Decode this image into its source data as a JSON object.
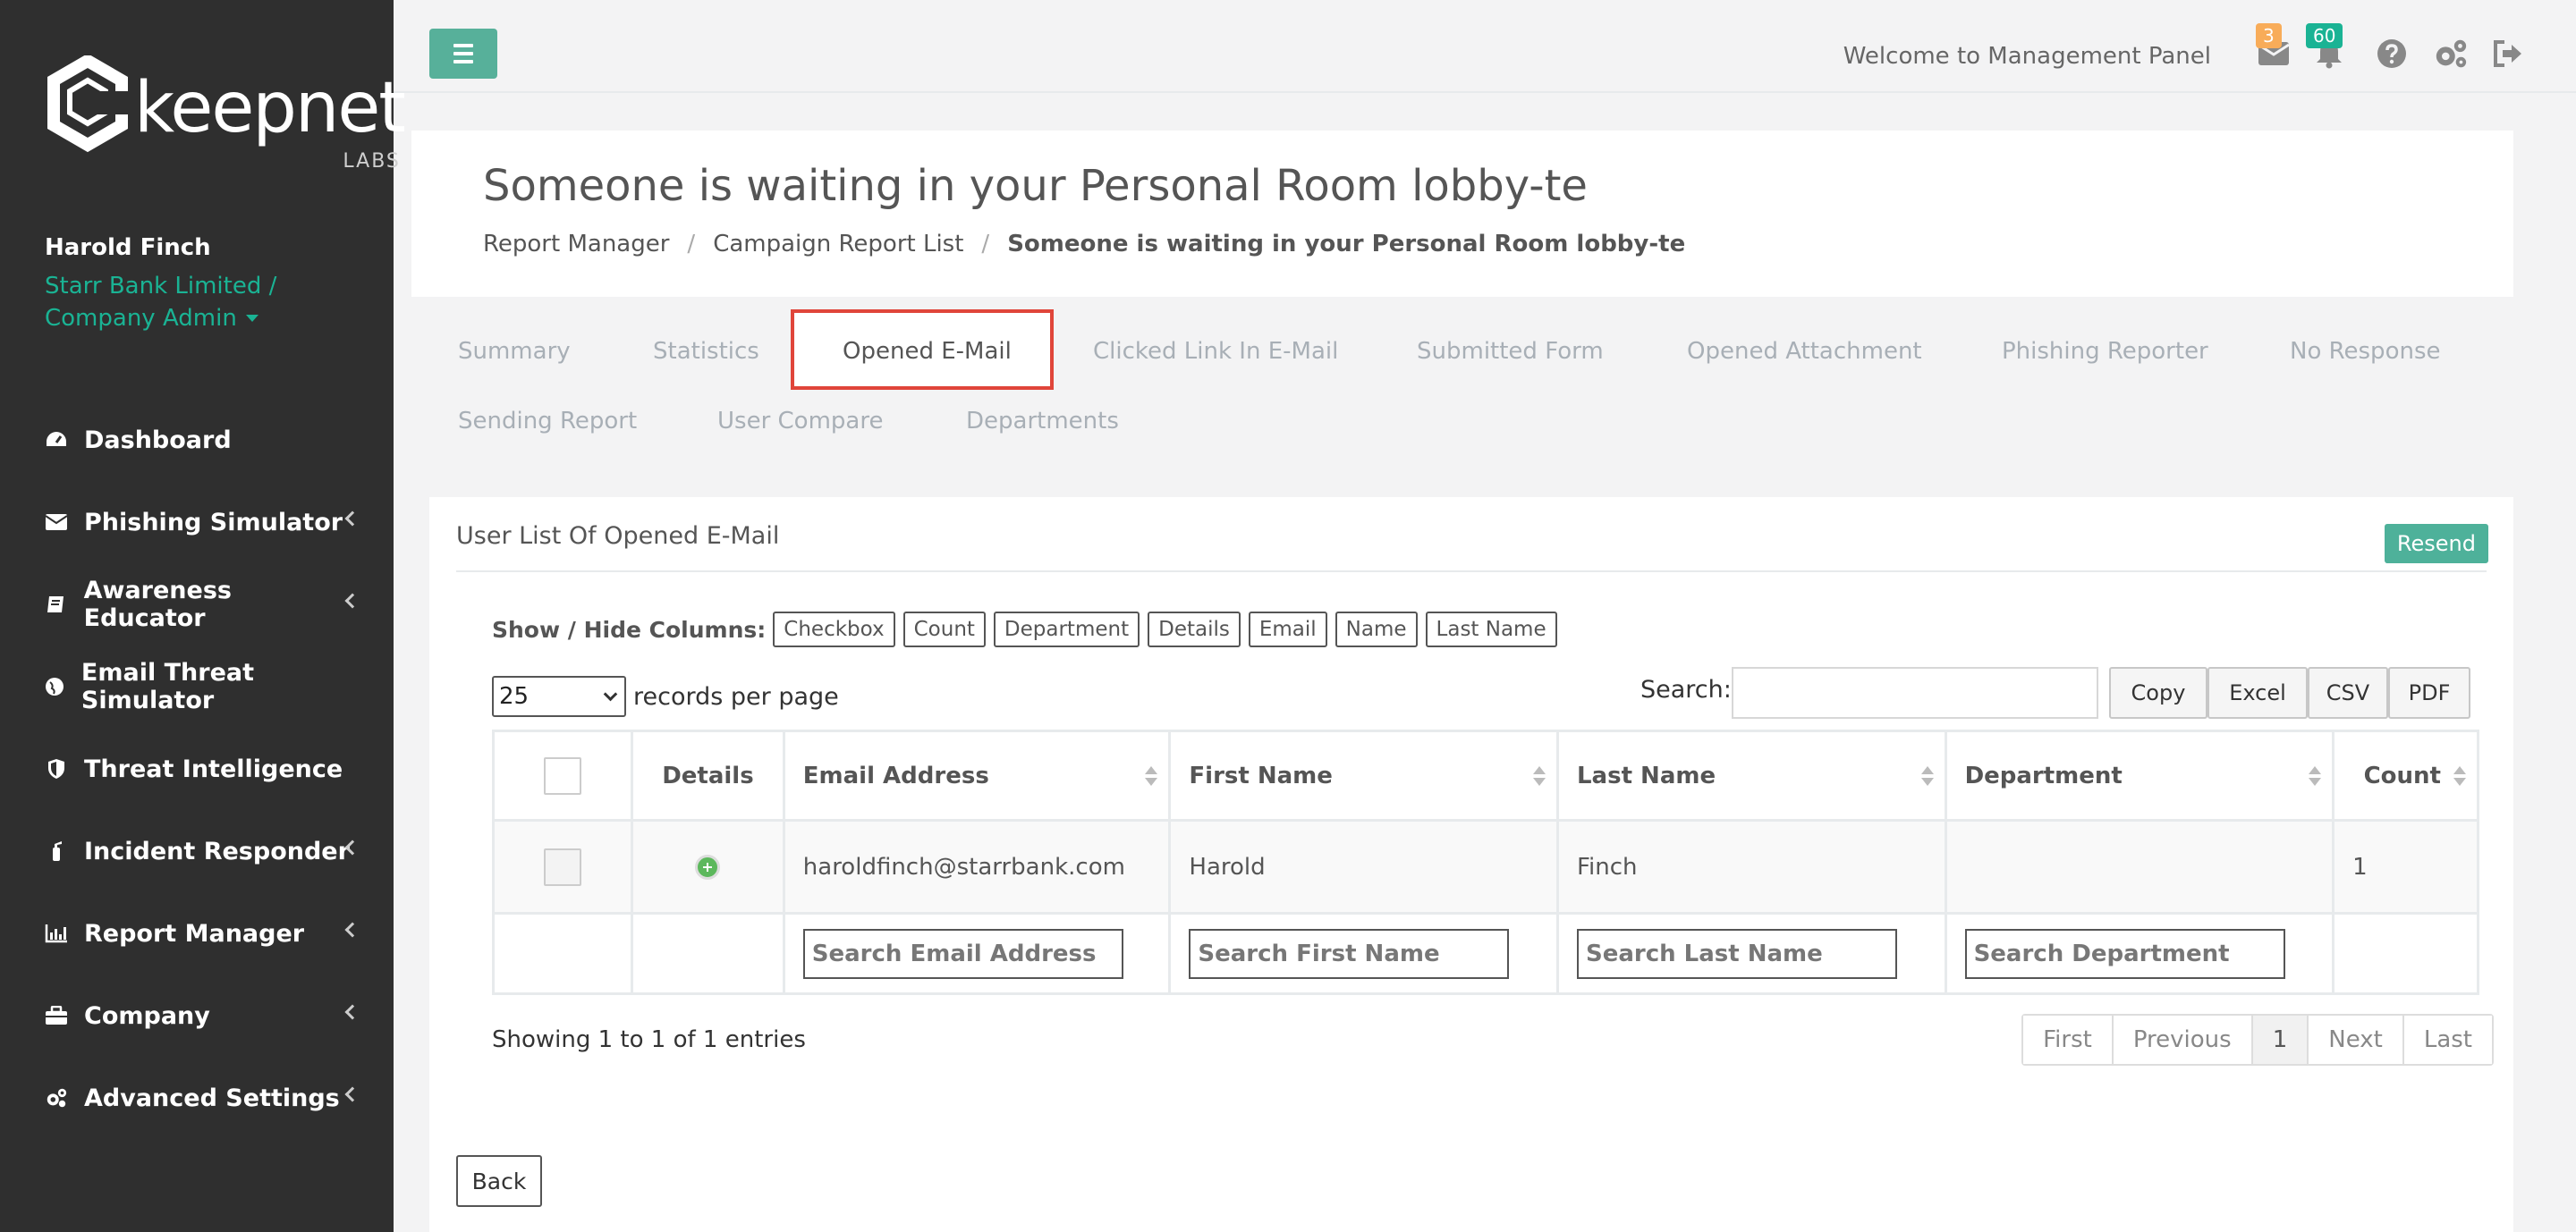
{
  "brand": {
    "word": "keepnet",
    "sub": "LABS"
  },
  "user": {
    "name": "Harold Finch",
    "company": "Starr Bank Limited /",
    "role": "Company Admin"
  },
  "nav": [
    {
      "label": "Dashboard",
      "icon": "dashboard-icon",
      "has_submenu": false
    },
    {
      "label": "Phishing Simulator",
      "icon": "envelope-icon",
      "has_submenu": true
    },
    {
      "label": "Awareness Educator",
      "icon": "book-icon",
      "has_submenu": true
    },
    {
      "label": "Email Threat Simulator",
      "icon": "globe-icon",
      "has_submenu": false
    },
    {
      "label": "Threat Intelligence",
      "icon": "shield-icon",
      "has_submenu": false
    },
    {
      "label": "Incident Responder",
      "icon": "fire-extinguisher-icon",
      "has_submenu": true
    },
    {
      "label": "Report Manager",
      "icon": "bar-chart-icon",
      "has_submenu": true
    },
    {
      "label": "Company",
      "icon": "briefcase-icon",
      "has_submenu": true
    },
    {
      "label": "Advanced Settings",
      "icon": "gears-icon",
      "has_submenu": true
    }
  ],
  "topbar": {
    "welcome": "Welcome to Management Panel",
    "mail_badge": "3",
    "bell_badge": "60"
  },
  "page": {
    "title": "Someone is waiting in your Personal Room lobby-te",
    "breadcrumb": [
      "Report Manager",
      "Campaign Report List",
      "Someone is waiting in your Personal Room lobby-te"
    ]
  },
  "tabs": {
    "row1": [
      "Summary",
      "Statistics",
      "Opened E-Mail",
      "Clicked Link In E-Mail",
      "Submitted Form",
      "Opened Attachment",
      "Phishing Reporter",
      "No Response"
    ],
    "row2": [
      "Sending Report",
      "User Compare",
      "Departments"
    ],
    "active": "Opened E-Mail"
  },
  "card": {
    "title": "User List Of Opened E-Mail",
    "resend": "Resend",
    "columns_label": "Show / Hide Columns:",
    "column_toggles": [
      "Checkbox",
      "Count",
      "Department",
      "Details",
      "Email",
      "Name",
      "Last Name"
    ],
    "records_per_page_value": "25",
    "records_per_page_text": "records per page",
    "search_label": "Search:",
    "export_buttons": [
      "Copy",
      "Excel",
      "CSV",
      "PDF"
    ]
  },
  "table": {
    "headers": [
      "Details",
      "Email Address",
      "First Name",
      "Last Name",
      "Department",
      "Count"
    ],
    "rows": [
      {
        "email": "haroldfinch@starrbank.com",
        "first": "Harold",
        "last": "Finch",
        "department": "",
        "count": "1"
      }
    ],
    "filters": [
      "Search Email Address",
      "Search First Name",
      "Search Last Name",
      "Search Department"
    ]
  },
  "footer": {
    "showing": "Showing 1 to 1 of 1 entries",
    "pager": [
      "First",
      "Previous",
      "1",
      "Next",
      "Last"
    ],
    "back": "Back"
  },
  "colors": {
    "accent": "#1ab394",
    "sidebar": "#2f2f2f",
    "active_tab_border": "#e0453a",
    "badge_orange": "#f8ac59"
  }
}
